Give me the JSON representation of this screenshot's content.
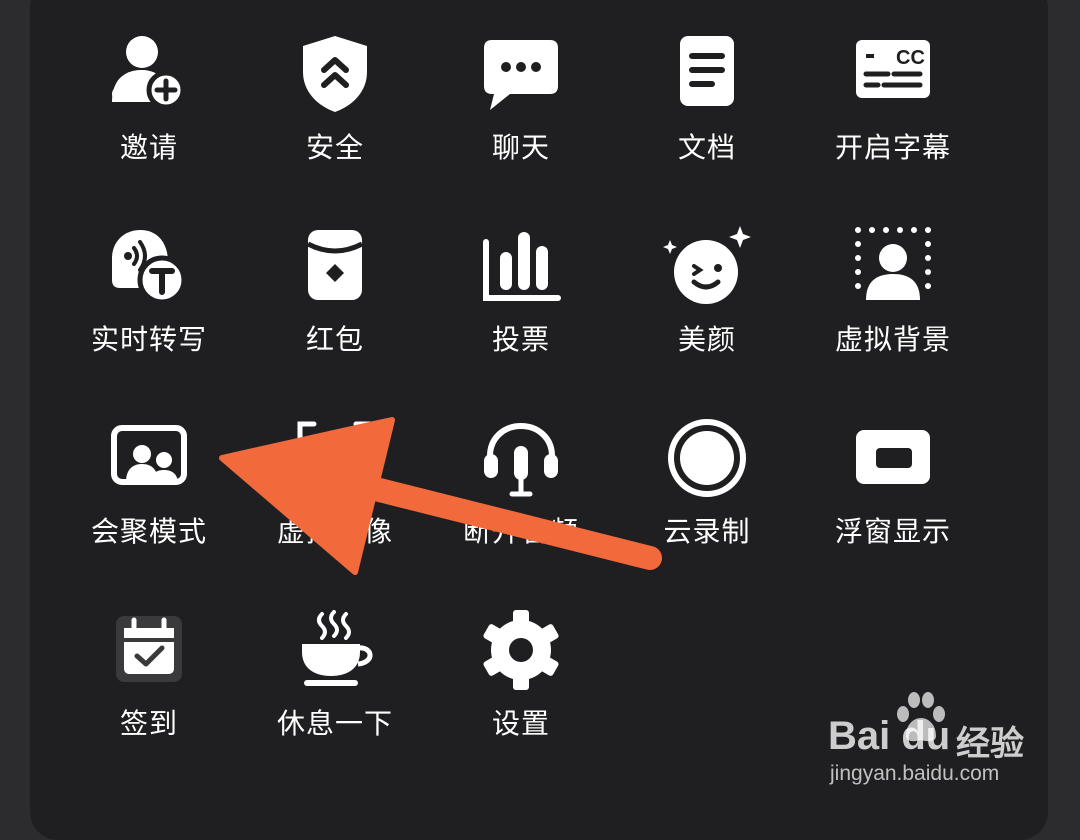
{
  "menu": {
    "items": [
      {
        "label": "邀请",
        "icon": "invite-user-icon"
      },
      {
        "label": "安全",
        "icon": "security-shield-icon"
      },
      {
        "label": "聊天",
        "icon": "chat-bubble-icon"
      },
      {
        "label": "文档",
        "icon": "document-icon"
      },
      {
        "label": "开启字幕",
        "icon": "subtitles-cc-icon"
      },
      {
        "label": "实时转写",
        "icon": "live-transcription-icon"
      },
      {
        "label": "红包",
        "icon": "red-packet-icon"
      },
      {
        "label": "投票",
        "icon": "vote-chart-icon"
      },
      {
        "label": "美颜",
        "icon": "beauty-face-icon"
      },
      {
        "label": "虚拟背景",
        "icon": "virtual-background-icon"
      },
      {
        "label": "会聚模式",
        "icon": "together-mode-icon"
      },
      {
        "label": "虚拟头像",
        "icon": "virtual-avatar-icon"
      },
      {
        "label": "断开音频",
        "icon": "headset-mic-icon"
      },
      {
        "label": "云录制",
        "icon": "cloud-record-icon"
      },
      {
        "label": "浮窗显示",
        "icon": "floating-window-icon"
      },
      {
        "label": "签到",
        "icon": "check-in-calendar-icon"
      },
      {
        "label": "休息一下",
        "icon": "coffee-break-icon"
      },
      {
        "label": "设置",
        "icon": "settings-gear-icon"
      }
    ]
  },
  "annotation": {
    "icon": "pointer-arrow-icon",
    "color": "#f26a3c",
    "points_to": "会聚模式"
  },
  "watermark": {
    "brand": "Bai du",
    "brand_cn": "经验",
    "url": "jingyan.baidu.com"
  }
}
